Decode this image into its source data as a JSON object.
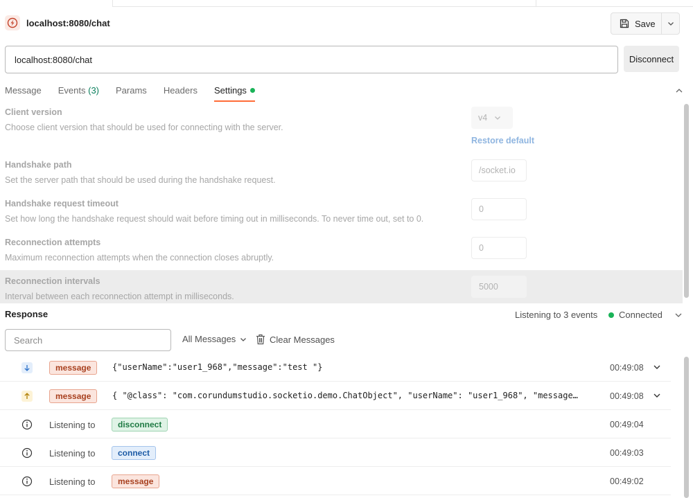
{
  "request": {
    "title": "localhost:8080/chat",
    "url": "localhost:8080/chat",
    "save_label": "Save",
    "disconnect_label": "Disconnect"
  },
  "tabs": [
    {
      "label": "Message"
    },
    {
      "label": "Events",
      "count": "(3)"
    },
    {
      "label": "Params"
    },
    {
      "label": "Headers"
    },
    {
      "label": "Settings",
      "active": true
    }
  ],
  "settings": {
    "client_version": {
      "title": "Client version",
      "desc": "Choose client version that should be used for connecting with the server.",
      "value": "v4",
      "restore_label": "Restore default"
    },
    "handshake_path": {
      "title": "Handshake path",
      "desc": "Set the server path that should be used during the handshake request.",
      "placeholder": "/socket.io"
    },
    "handshake_timeout": {
      "title": "Handshake request timeout",
      "desc": "Set how long the handshake request should wait before timing out in milliseconds. To never time out, set to 0.",
      "placeholder": "0"
    },
    "reconnection_attempts": {
      "title": "Reconnection attempts",
      "desc": "Maximum reconnection attempts when the connection closes abruptly.",
      "placeholder": "0"
    },
    "reconnection_intervals": {
      "title": "Reconnection intervals",
      "desc": "Interval between each reconnection attempt in milliseconds.",
      "placeholder": "5000"
    }
  },
  "response": {
    "title": "Response",
    "listening": "Listening to 3 events",
    "status": "Connected",
    "status_color": "#1ab358",
    "search_placeholder": "Search",
    "filter_label": "All Messages",
    "clear_label": "Clear Messages"
  },
  "messages": [
    {
      "direction": "incoming",
      "event": "message",
      "payload": "{\"userName\":\"user1_968\",\"message\":\"test \"}",
      "time": "00:49:08"
    },
    {
      "direction": "outgoing",
      "event": "message",
      "payload": "{ \"@class\": \"com.corundumstudio.socketio.demo.ChatObject\", \"userName\": \"user1_968\", \"message…",
      "time": "00:49:08"
    },
    {
      "label": "Listening to",
      "event": "disconnect",
      "time": "00:49:04"
    },
    {
      "label": "Listening to",
      "event": "connect",
      "time": "00:49:03"
    },
    {
      "label": "Listening to",
      "event": "message",
      "time": "00:49:02"
    }
  ],
  "colors": {
    "accent": "#ff6c37",
    "connected": "#1ab358"
  }
}
